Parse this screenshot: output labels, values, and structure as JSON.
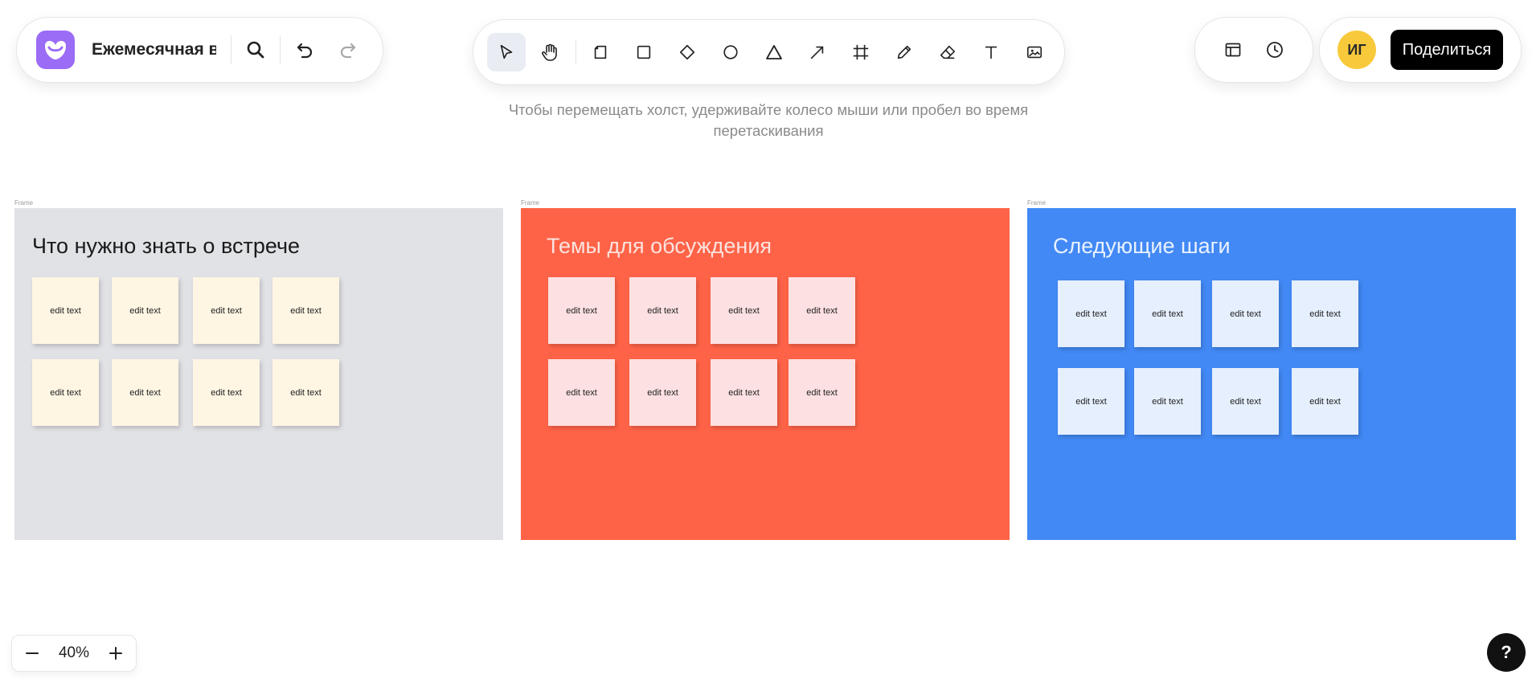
{
  "header": {
    "board_title": "Ежемесячная в",
    "hint": "Чтобы перемещать холст, удерживайте колесо мыши или пробел во время перетаскивания",
    "avatar_initials": "ИГ",
    "share_label": "Поделиться"
  },
  "toolbar": {
    "tools": [
      "select-tool",
      "hand-tool",
      "sticky-note-tool",
      "rectangle-tool",
      "diamond-tool",
      "ellipse-tool",
      "triangle-tool",
      "arrow-tool",
      "frame-tool",
      "pencil-tool",
      "eraser-tool",
      "text-tool",
      "image-tool"
    ],
    "active_tool": "select-tool"
  },
  "frames": [
    {
      "label": "Frame",
      "title": "Что нужно знать о встрече",
      "color": "#e1e2e6",
      "title_color": "#1a1a1a",
      "sticky_color": "#fef5e3",
      "stickies": [
        "edit text",
        "edit text",
        "edit text",
        "edit text",
        "edit text",
        "edit text",
        "edit text",
        "edit text"
      ]
    },
    {
      "label": "Frame",
      "title": "Темы для обсуждения",
      "color": "#ff6347",
      "title_color": "#fbe3de",
      "sticky_color": "#fde0e1",
      "stickies": [
        "edit text",
        "edit text",
        "edit text",
        "edit text",
        "edit text",
        "edit text",
        "edit text",
        "edit text"
      ]
    },
    {
      "label": "Frame",
      "title": "Следующие шаги",
      "color": "#4289f5",
      "title_color": "#eaf2ff",
      "sticky_color": "#e5effd",
      "stickies": [
        "edit text",
        "edit text",
        "edit text",
        "edit text",
        "edit text",
        "edit text",
        "edit text",
        "edit text"
      ]
    }
  ],
  "zoom": {
    "minus": "−",
    "value": "40%",
    "plus": "+"
  },
  "help_label": "?"
}
